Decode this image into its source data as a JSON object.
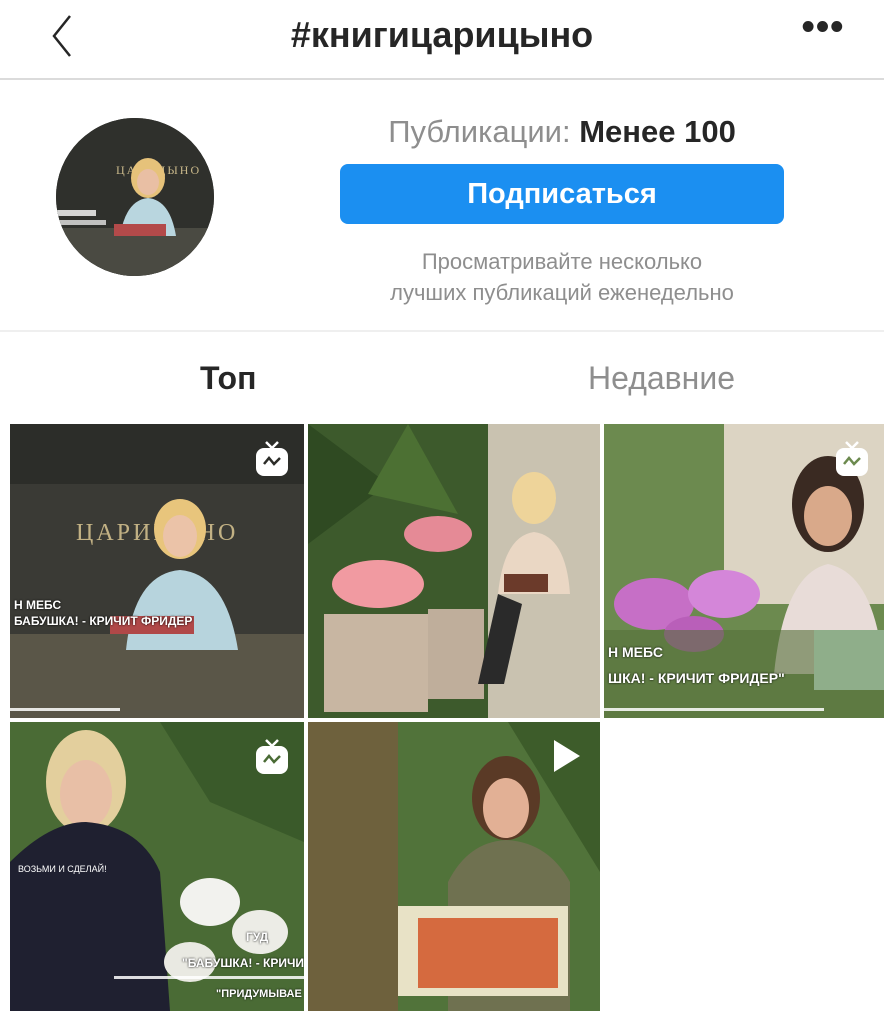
{
  "header": {
    "title": "#книгицарицыно"
  },
  "profile": {
    "posts_label": "Публикации:",
    "posts_value": "Менее 100",
    "follow_label": "Подписаться",
    "hint_line1": "Просматривайте несколько",
    "hint_line2": "лучших публикаций еженедельно",
    "avatar_sign": "ЦАРИЦЫНО"
  },
  "tabs": {
    "top": "Топ",
    "recent": "Недавние"
  },
  "colors": {
    "accent": "#1b8ff1",
    "text": "#262626",
    "muted": "#8e8e8e"
  },
  "icons": {
    "back": "chevron-left-icon",
    "more": "more-dots-icon",
    "igtv": "igtv-icon",
    "video": "play-icon"
  },
  "posts": [
    {
      "type": "igtv",
      "sign": "ЦАРИЦЫНО",
      "caption1": "Н МЕБС",
      "caption2": "БАБУШКА! - КРИЧИТ ФРИДЕР"
    },
    {
      "type": "photo"
    },
    {
      "type": "igtv",
      "caption1": "Н МЕБС",
      "caption2": "ШКА! - КРИЧИТ ФРИДЕР\""
    },
    {
      "type": "igtv",
      "shirt_text": "ВОЗЬМИ И СДЕЛАЙ!",
      "caption1": "ГУД",
      "caption2": "\"БАБУШКА! - КРИЧИТ",
      "caption3": "\"ПРИДУМЫВАЕ"
    },
    {
      "type": "video"
    }
  ]
}
